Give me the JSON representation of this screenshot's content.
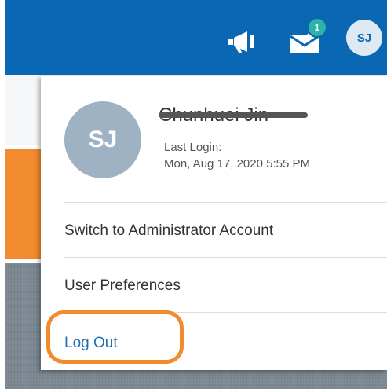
{
  "header": {
    "avatar_initials": "SJ",
    "notification_count": "1",
    "announcement_icon": "megaphone-icon",
    "inbox_icon": "envelope-check-icon"
  },
  "profile": {
    "initials": "SJ",
    "name": "Chunhuei Jin",
    "last_login_label": "Last Login:",
    "last_login_value": "Mon, Aug 17, 2020 5:55 PM"
  },
  "menu": {
    "items": [
      {
        "label": "Switch to Administrator Account"
      },
      {
        "label": "User Preferences"
      },
      {
        "label": "Log Out"
      }
    ]
  },
  "colors": {
    "header_bg": "#0a67b4",
    "highlight": "#f28a2e",
    "link": "#1f6fb5"
  }
}
